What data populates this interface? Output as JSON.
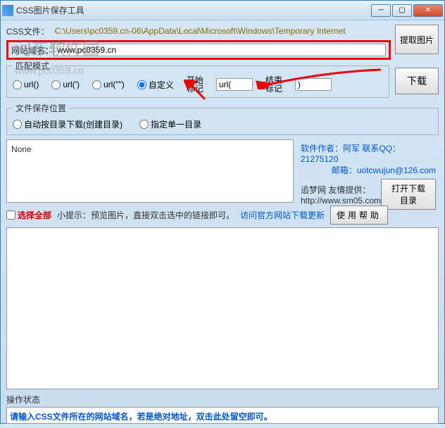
{
  "window": {
    "title": "CSS图片保存工具"
  },
  "watermark": "河东软件园",
  "watermark_url": "www.pc0359.cn",
  "labels": {
    "css_file": "CSS文件：",
    "domain": "网站域名：",
    "match_mode": "匹配模式",
    "save_location": "文件保存位置",
    "start_mark": "开始\n标记",
    "end_mark": "结束\n标记",
    "status": "操作状态"
  },
  "values": {
    "css_path": "C:\\Users\\pc0359.cn-06\\AppData\\Local\\Microsoft\\Windows\\Temporary Internet",
    "domain": "www.pc0359.cn",
    "start_mark": "url(",
    "end_mark": ")",
    "preview": "None",
    "status_text": "请输入CSS文件所在的网站域名，若是绝对地址，双击此处留空即可。"
  },
  "buttons": {
    "extract": "提取图片",
    "download": "下载",
    "open_dir": "打开下载目录",
    "help": "使用帮助"
  },
  "radios": {
    "url1": "url()",
    "url2": "url(')",
    "url3": "url(\"\")",
    "custom": "自定义",
    "auto_save": "自动按目录下载(创建目录)",
    "single_dir": "指定单一目录"
  },
  "checkbox": {
    "select_all": "选择全部"
  },
  "tips": {
    "preview_tip": "小提示：预览图片，直接双击选中的链接即可。",
    "visit_site": "访问官方网站下载更新"
  },
  "info": {
    "author": "软件作者：阿军 联系QQ：21275120",
    "email": "邮箱：uotcwujun@126.com",
    "site_label": "追梦网 友情提供：",
    "site_url": "http://www.sm05.com"
  }
}
